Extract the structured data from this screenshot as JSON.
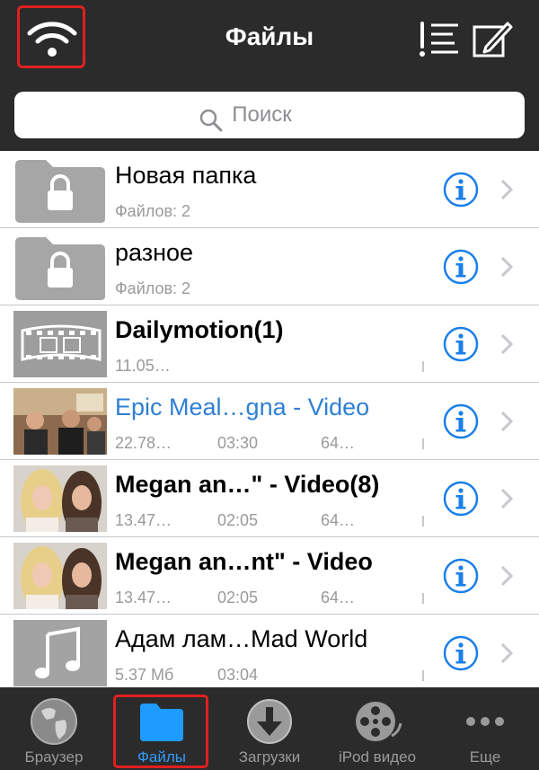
{
  "header": {
    "title": "Файлы"
  },
  "search": {
    "placeholder": "Поиск"
  },
  "files": [
    {
      "name": "Новая папка",
      "meta": [
        "Файлов: 2",
        "",
        ""
      ],
      "type": "folder",
      "style": "normal"
    },
    {
      "name": "разное",
      "meta": [
        "Файлов: 2",
        "",
        ""
      ],
      "type": "folder",
      "style": "normal"
    },
    {
      "name": "Dailymotion(1)",
      "meta": [
        "11.05…",
        "",
        ""
      ],
      "type": "film",
      "style": "bold"
    },
    {
      "name": "Epic Meal…gna - Video",
      "meta": [
        "22.78…",
        "03:30",
        "64…"
      ],
      "type": "video-epic",
      "style": "blue"
    },
    {
      "name": "Megan an…\" - Video(8)",
      "meta": [
        "13.47…",
        "02:05",
        "64…"
      ],
      "type": "video-megan",
      "style": "bold"
    },
    {
      "name": "Megan an…nt\" - Video",
      "meta": [
        "13.47…",
        "02:05",
        "64…"
      ],
      "type": "video-megan",
      "style": "bold"
    },
    {
      "name": "Адам лам…Mad World",
      "meta": [
        "5.37 Мб",
        "03:04",
        ""
      ],
      "type": "music",
      "style": "normal"
    }
  ],
  "tabs": [
    {
      "label": "Браузер",
      "icon": "globe-icon",
      "active": false
    },
    {
      "label": "Файлы",
      "icon": "folder-icon",
      "active": true
    },
    {
      "label": "Загрузки",
      "icon": "download-icon",
      "active": false
    },
    {
      "label": "iPod видео",
      "icon": "film-reel-icon",
      "active": false
    },
    {
      "label": "Еще",
      "icon": "more-icon",
      "active": false
    }
  ],
  "colors": {
    "bar": "#2b2b2b",
    "accent": "#2f7fd4",
    "tab_active": "#2f9bff",
    "highlight": "#e02020"
  }
}
